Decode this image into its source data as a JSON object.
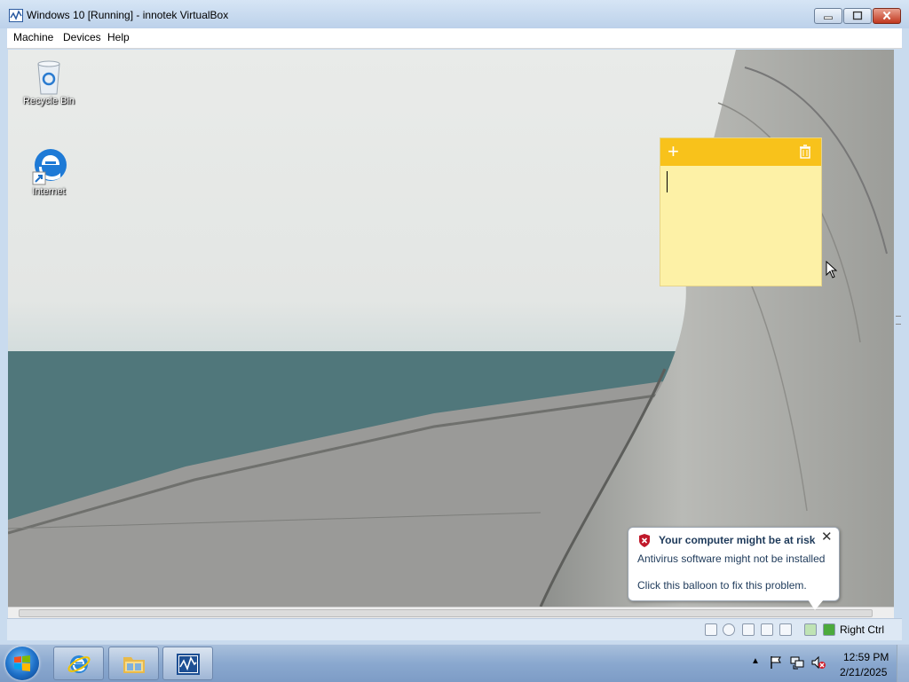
{
  "window": {
    "title": "Windows 10 [Running] - innotek VirtualBox",
    "buttons": {
      "minimize": "minimize-icon",
      "maximize": "maximize-icon",
      "close": "close-icon"
    }
  },
  "menubar": {
    "items": [
      "Machine",
      "Devices",
      "Help"
    ]
  },
  "desktop": {
    "icons": [
      {
        "label": "Recycle Bin",
        "icon": "recycle-bin-icon"
      },
      {
        "label": "Internet",
        "icon": "edge-icon"
      }
    ]
  },
  "sticky_note": {
    "add": "+",
    "delete_icon": "trash-icon",
    "color": "#fdf1a6",
    "header_color": "#f8c21b"
  },
  "balloon": {
    "title": "Your computer might be at risk",
    "line1": "Antivirus software might not be installed",
    "line2": "Click this balloon to fix this problem.",
    "close": "✕"
  },
  "statusbar": {
    "host_key": "Right Ctrl"
  },
  "taskbar": {
    "pinned": [
      "internet-explorer-icon",
      "folder-icon",
      "virtualbox-icon"
    ],
    "tray_arrow": "▲",
    "time": "12:59 PM",
    "date": "2/21/2025"
  }
}
